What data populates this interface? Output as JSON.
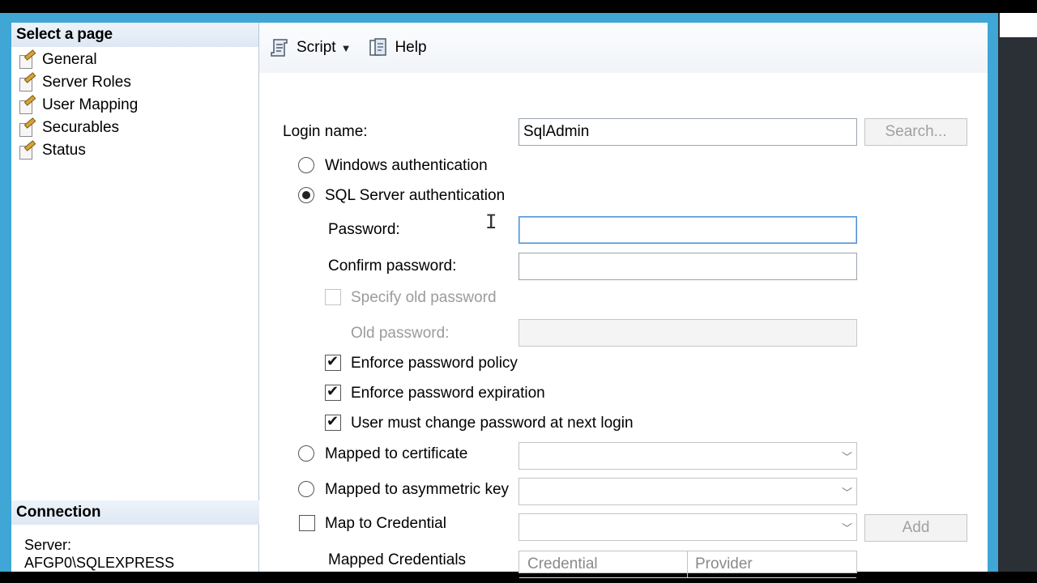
{
  "left_panel": {
    "select_header": "Select a page",
    "pages": [
      {
        "label": "General"
      },
      {
        "label": "Server Roles"
      },
      {
        "label": "User Mapping"
      },
      {
        "label": "Securables"
      },
      {
        "label": "Status"
      }
    ],
    "connection_header": "Connection",
    "server_label": "Server:",
    "server_value": "AFGP0\\SQLEXPRESS"
  },
  "toolbar": {
    "script_label": "Script",
    "help_label": "Help"
  },
  "form": {
    "login_name_label": "Login name:",
    "login_name_value": "SqlAdmin",
    "search_button": "Search...",
    "windows_auth": "Windows authentication",
    "sql_auth": "SQL Server authentication",
    "password_label": "Password:",
    "password_value": "",
    "confirm_label": "Confirm password:",
    "confirm_value": "",
    "specify_old": "Specify old password",
    "old_password_label": "Old password:",
    "enforce_policy": "Enforce password policy",
    "enforce_expiration": "Enforce password expiration",
    "must_change": "User must change password at next login",
    "mapped_cert": "Mapped to certificate",
    "mapped_asym": "Mapped to asymmetric key",
    "map_credential": "Map to Credential",
    "add_button": "Add",
    "mapped_credentials_label": "Mapped Credentials",
    "grid_columns": [
      "Credential",
      "Provider"
    ]
  }
}
